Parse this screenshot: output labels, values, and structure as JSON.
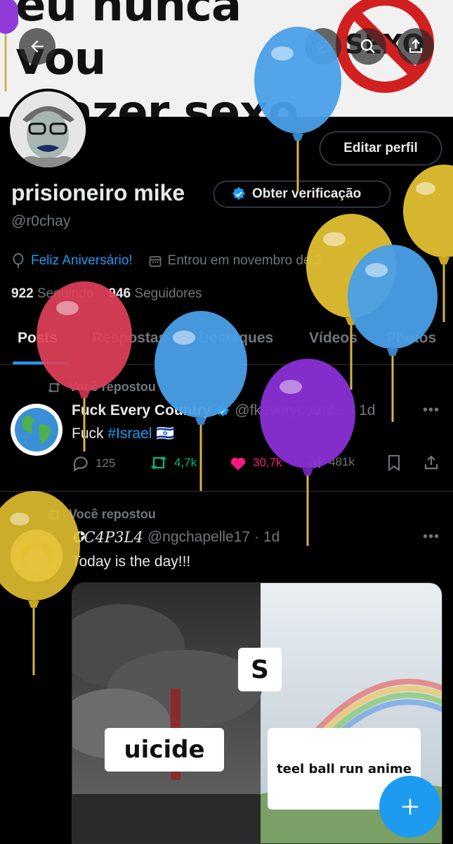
{
  "banner": {
    "line1": "eu nunca vou",
    "line2": "fazer sexo",
    "sign_text": "SEXO"
  },
  "profile": {
    "name": "prisioneiro mike",
    "handle": "@r0chay",
    "edit_label": "Editar perfil",
    "verify_label": "Obter verificação",
    "birthday": "Feliz Aniversário!",
    "joined": "Entrou em novembro de 2",
    "following_count": "922",
    "following_label": "Seguindo",
    "followers_count": "946",
    "followers_label": "Seguidores"
  },
  "tabs": [
    "Posts",
    "Respostas",
    "Destaques",
    "Vídeos",
    "Photos"
  ],
  "posts": [
    {
      "repost_label": "Você repostou",
      "name": "Fuck Every Country",
      "handle": "@fkeverycount...",
      "time": "· 1d",
      "text_prefix": "Fuck ",
      "hashtag": "#Israel",
      "flag": "🇮🇱",
      "replies": "125",
      "reposts": "4,7k",
      "likes": "30,7k",
      "views": "481k"
    },
    {
      "repost_label": "Você repostou",
      "name": "✪C4P3L4",
      "handle": "@ngchapelle17",
      "time": "· 1d",
      "text": "Today is the day!!!",
      "meme": {
        "top_letter": "S",
        "left_label": "uicide",
        "right_label": "teel ball run anime"
      }
    }
  ],
  "colors": {
    "accent": "#1d9bf0",
    "repost_green": "#00ba7c",
    "like_pink": "#f91880",
    "muted": "#71767b",
    "balloon_blue": "#4a9fe8",
    "balloon_yellow": "#e2c030",
    "balloon_red": "#e0405a",
    "balloon_purple": "#8a2fd6"
  }
}
